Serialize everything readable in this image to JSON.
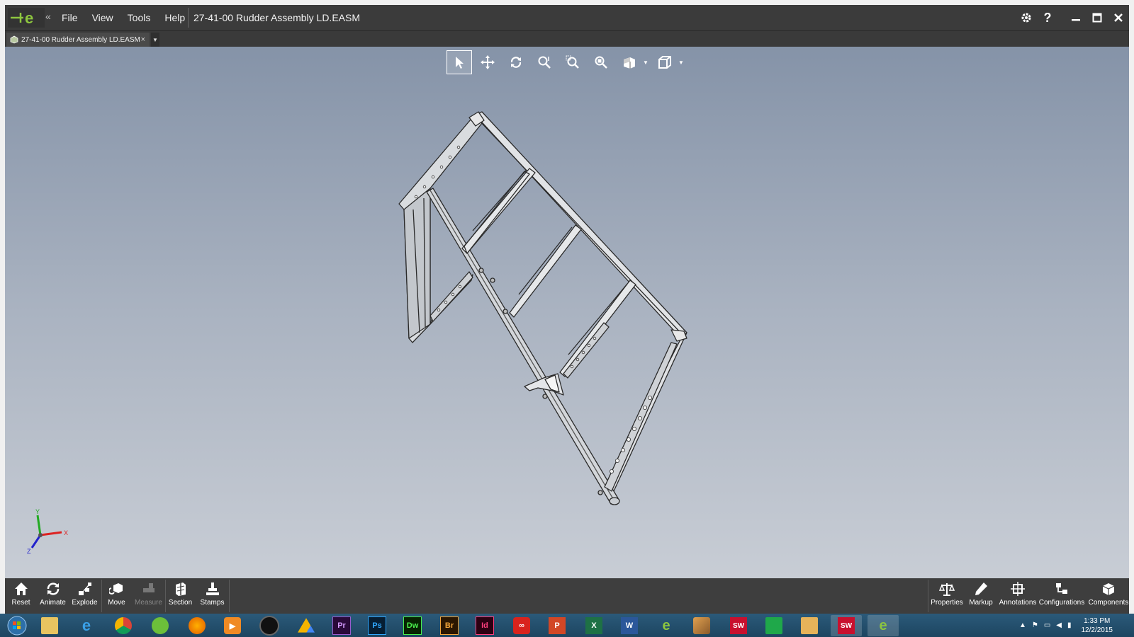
{
  "app": {
    "menu": [
      "File",
      "View",
      "Tools",
      "Help"
    ],
    "document_title": "27-41-00 Rudder Assembly LD.EASM"
  },
  "tabs": [
    {
      "label": "27-41-00 Rudder Assembly LD.EASM",
      "close": "×"
    }
  ],
  "view_toolbar": [
    {
      "name": "select-tool",
      "icon": "arrow-cursor-icon",
      "active": true
    },
    {
      "name": "pan-tool",
      "icon": "move-arrows-icon"
    },
    {
      "name": "rotate-tool",
      "icon": "rotate-icon"
    },
    {
      "name": "zoom-tool",
      "icon": "zoom-icon"
    },
    {
      "name": "zoom-area-tool",
      "icon": "zoom-area-icon"
    },
    {
      "name": "zoom-fit-tool",
      "icon": "zoom-fit-icon"
    },
    {
      "name": "view-orientation-tool",
      "icon": "cube-views-icon"
    },
    {
      "name": "display-style-tool",
      "icon": "box-display-icon"
    }
  ],
  "triad_axes": [
    "X",
    "Y",
    "Z"
  ],
  "bottom_toolbar": {
    "left": [
      {
        "label": "Reset",
        "icon": "home-icon"
      },
      {
        "label": "Animate",
        "icon": "animate-icon"
      },
      {
        "label": "Explode",
        "icon": "explode-icon"
      },
      {
        "label": "Move",
        "icon": "move-part-icon"
      },
      {
        "label": "Measure",
        "icon": "measure-icon",
        "disabled": true
      },
      {
        "label": "Section",
        "icon": "section-icon"
      },
      {
        "label": "Stamps",
        "icon": "stamp-icon"
      }
    ],
    "right": [
      {
        "label": "Properties",
        "icon": "scales-icon"
      },
      {
        "label": "Markup",
        "icon": "pencil-icon"
      },
      {
        "label": "Annotations",
        "icon": "annotation-icon"
      },
      {
        "label": "Configurations",
        "icon": "configurations-icon"
      },
      {
        "label": "Components",
        "icon": "components-icon"
      }
    ]
  },
  "taskbar": {
    "apps": [
      {
        "name": "start",
        "label": ""
      },
      {
        "name": "file-explorer",
        "label": ""
      },
      {
        "name": "internet-explorer",
        "label": "e"
      },
      {
        "name": "chrome",
        "label": ""
      },
      {
        "name": "green-app",
        "label": ""
      },
      {
        "name": "firefox",
        "label": ""
      },
      {
        "name": "media-player",
        "label": ""
      },
      {
        "name": "camera-app",
        "label": ""
      },
      {
        "name": "google-drive",
        "label": ""
      },
      {
        "name": "premiere",
        "label": "Pr"
      },
      {
        "name": "photoshop",
        "label": "Ps"
      },
      {
        "name": "dreamweaver",
        "label": "Dw"
      },
      {
        "name": "bridge",
        "label": "Br"
      },
      {
        "name": "indesign",
        "label": "Id"
      },
      {
        "name": "creative-cloud",
        "label": ""
      },
      {
        "name": "powerpoint",
        "label": "P"
      },
      {
        "name": "excel",
        "label": "X"
      },
      {
        "name": "word",
        "label": "W"
      },
      {
        "name": "edrawings",
        "label": "e"
      },
      {
        "name": "stylus-app",
        "label": ""
      },
      {
        "name": "solidworks-2016",
        "label": "SW"
      },
      {
        "name": "green-tile-app",
        "label": ""
      },
      {
        "name": "folder-app",
        "label": ""
      },
      {
        "name": "solidworks-2016-b",
        "label": "SW"
      },
      {
        "name": "edrawings-2016",
        "label": "e"
      }
    ],
    "time": "1:33 PM",
    "date": "12/2/2015"
  },
  "colors": {
    "viewport_top": "#8593a8",
    "viewport_bottom": "#c8cdd5",
    "chrome": "#3e3e3e",
    "logo_green": "#8dc63f"
  }
}
